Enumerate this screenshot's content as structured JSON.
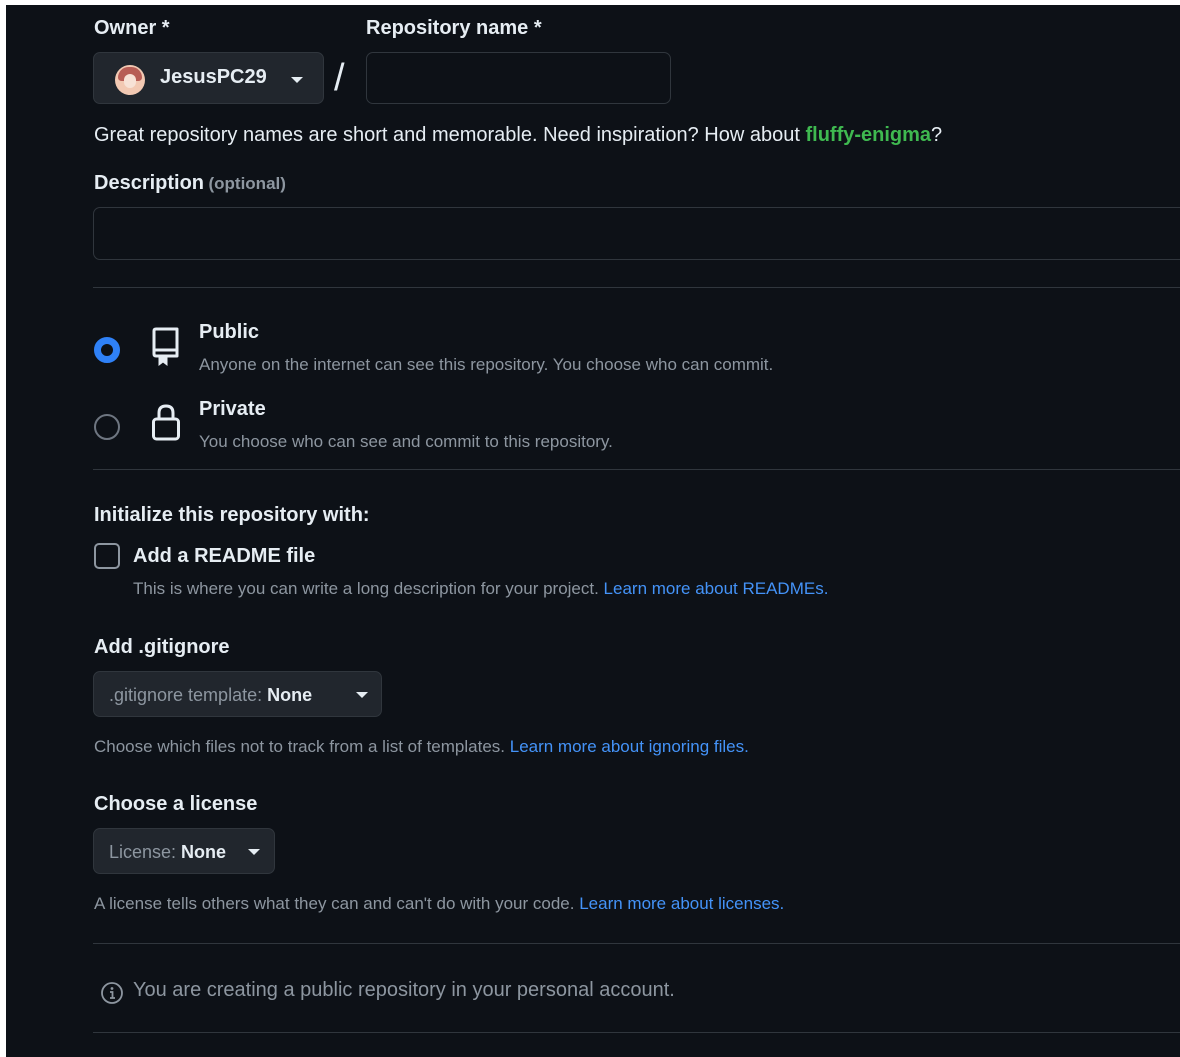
{
  "owner": {
    "label": "Owner *",
    "name": "JesusPC29"
  },
  "repository": {
    "label": "Repository name *",
    "value": "",
    "separator": "/",
    "hint_prefix": "Great repository names are short and memorable. Need inspiration? How about ",
    "suggestion": "fluffy-enigma",
    "hint_suffix": "?"
  },
  "description": {
    "label": "Description",
    "optional": "(optional)",
    "value": ""
  },
  "visibility": {
    "selected": "public",
    "options": [
      {
        "title": "Public",
        "desc": "Anyone on the internet can see this repository. You choose who can commit."
      },
      {
        "title": "Private",
        "desc": "You choose who can see and commit to this repository."
      }
    ]
  },
  "initialize": {
    "heading": "Initialize this repository with:",
    "readme": {
      "label": "Add a README file",
      "checked": false,
      "desc": "This is where you can write a long description for your project. ",
      "link": "Learn more about READMEs."
    }
  },
  "gitignore": {
    "heading": "Add .gitignore",
    "select_prefix": ".gitignore template: ",
    "select_value": "None",
    "help": "Choose which files not to track from a list of templates. ",
    "link": "Learn more about ignoring files."
  },
  "license": {
    "heading": "Choose a license",
    "select_prefix": "License: ",
    "select_value": "None",
    "help": "A license tells others what they can and can't do with your code. ",
    "link": "Learn more about licenses."
  },
  "notice": {
    "text": "You are creating a public repository in your personal account."
  },
  "colors": {
    "background": "#0d1117",
    "text": "#e6edf3",
    "muted": "#8d96a0",
    "border": "#30363d",
    "accent": "#2f81f7",
    "link": "#4493f8",
    "suggestion": "#3fb950"
  },
  "icons": {
    "owner_dropdown": "chevron-down-icon",
    "public": "repo-icon",
    "private": "lock-icon",
    "notice": "info-icon"
  }
}
